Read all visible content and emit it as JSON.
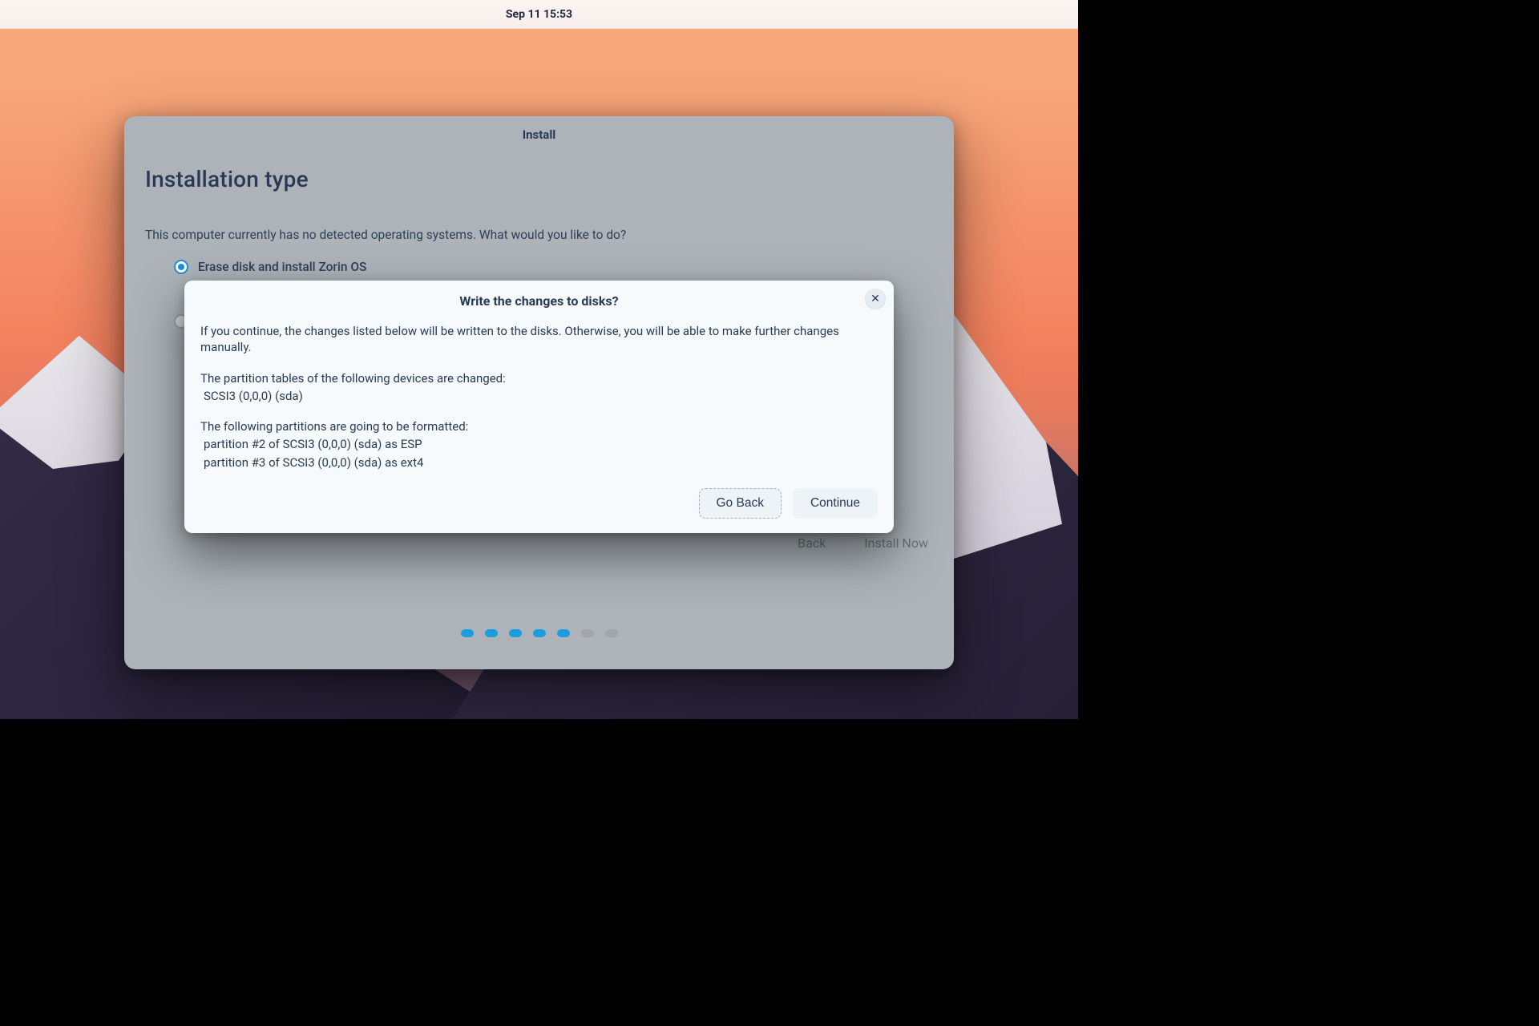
{
  "topbar": {
    "clock": "Sep 11  15:53"
  },
  "installer": {
    "header": "Install",
    "title": "Installation type",
    "lead": "This computer currently has no detected operating systems. What would you like to do?",
    "option_erase": "Erase disk and install Zorin OS",
    "back_label": "Back",
    "install_now_label": "Install Now",
    "progress": {
      "total": 7,
      "active": 5
    }
  },
  "dialog": {
    "title": "Write the changes to disks?",
    "intro": "If you continue, the changes listed below will be written to the disks. Otherwise, you will be able to make further changes manually.",
    "pt_heading": "The partition tables of the following devices are changed:",
    "pt_line1": " SCSI3 (0,0,0) (sda)",
    "fmt_heading": "The following partitions are going to be formatted:",
    "fmt_line1": " partition #2 of SCSI3 (0,0,0) (sda) as ESP",
    "fmt_line2": " partition #3 of SCSI3 (0,0,0) (sda) as ext4",
    "go_back": "Go Back",
    "continue": "Continue"
  }
}
